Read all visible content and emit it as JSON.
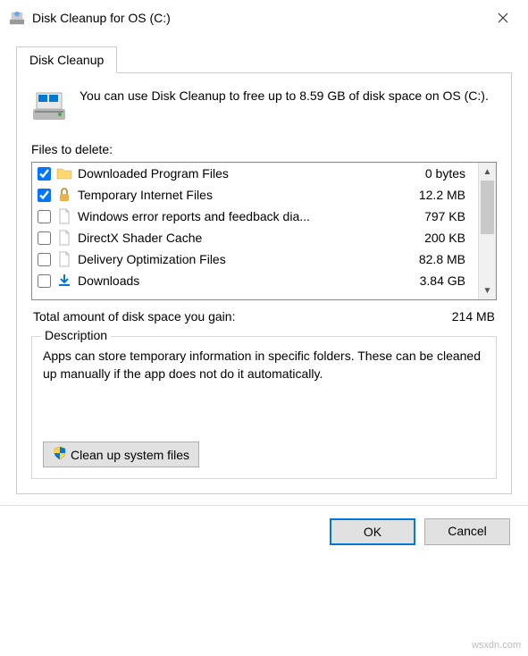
{
  "window": {
    "title": "Disk Cleanup for OS (C:)"
  },
  "tabs": {
    "active": "Disk Cleanup"
  },
  "info": {
    "text": "You can use Disk Cleanup to free up to 8.59 GB of disk space on OS (C:)."
  },
  "files_label": "Files to delete:",
  "files": [
    {
      "checked": true,
      "icon": "folder",
      "name": "Downloaded Program Files",
      "size": "0 bytes"
    },
    {
      "checked": true,
      "icon": "lock",
      "name": "Temporary Internet Files",
      "size": "12.2 MB"
    },
    {
      "checked": false,
      "icon": "file",
      "name": "Windows error reports and feedback dia...",
      "size": "797 KB"
    },
    {
      "checked": false,
      "icon": "file",
      "name": "DirectX Shader Cache",
      "size": "200 KB"
    },
    {
      "checked": false,
      "icon": "file",
      "name": "Delivery Optimization Files",
      "size": "82.8 MB"
    },
    {
      "checked": false,
      "icon": "download",
      "name": "Downloads",
      "size": "3.84 GB"
    }
  ],
  "total": {
    "label": "Total amount of disk space you gain:",
    "value": "214 MB"
  },
  "description": {
    "legend": "Description",
    "text": "Apps can store temporary information in specific folders. These can be cleaned up manually if the app does not do it automatically."
  },
  "system_files_button": "Clean up system files",
  "buttons": {
    "ok": "OK",
    "cancel": "Cancel"
  },
  "watermark": "wsxdn.com"
}
